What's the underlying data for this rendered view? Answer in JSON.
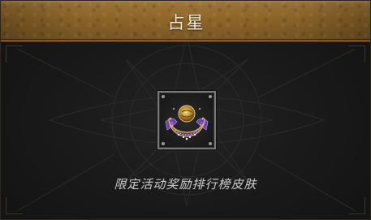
{
  "dialog": {
    "title": "占星",
    "description": "限定活动奖励排行榜皮肤"
  },
  "reward": {
    "icon": "crescent-moon-astrology-emblem-icon"
  },
  "colors": {
    "header_gold": "#8a6428",
    "header_border": "#c59a4c",
    "title_text": "#f3ead7",
    "panel_bg": "#1a1a1a",
    "slot_border": "#7a7a7a",
    "emblem_purple": "#7b4fc9",
    "emblem_gold": "#d9b45a",
    "description_text": "#cfcfcf"
  }
}
